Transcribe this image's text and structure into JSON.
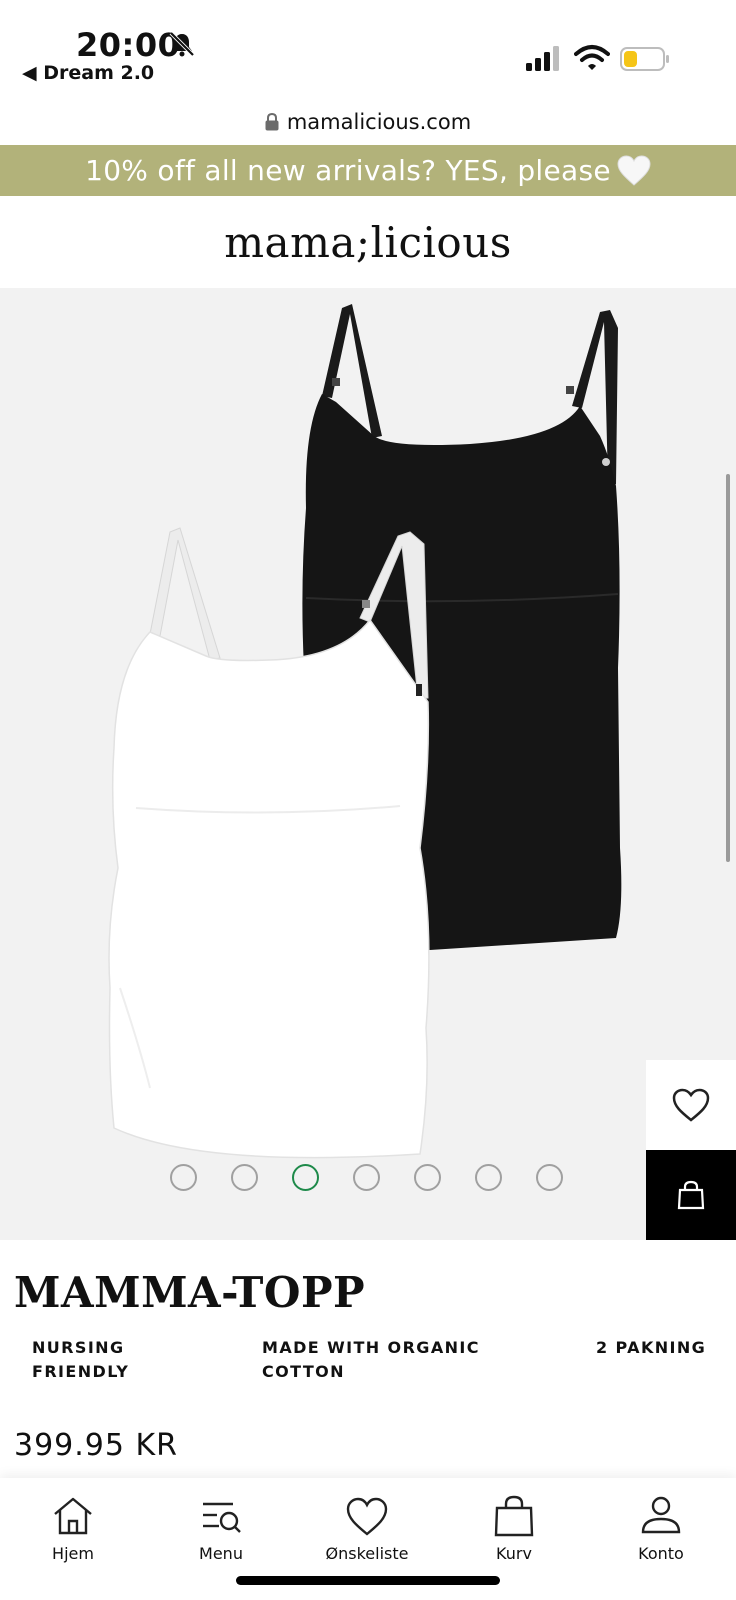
{
  "status_bar": {
    "time": "20:00",
    "back_app": "◀ Dream 2.0",
    "battery_color": "#f5c518"
  },
  "browser": {
    "url": "mamalicious.com"
  },
  "promo": {
    "text": "10% off all new arrivals? YES, please",
    "background": "#b2b27a"
  },
  "brand": {
    "logo": "mama;licious"
  },
  "gallery": {
    "dot_count": 7,
    "active_index": 2,
    "active_color": "#1e8a4a"
  },
  "product": {
    "title": "MAMMA-TOPP",
    "features": [
      "NURSING FRIENDLY",
      "MADE WITH ORGANIC COTTON",
      "2 PAKNING"
    ],
    "price": "399.95 KR"
  },
  "bottom_nav": {
    "items": [
      {
        "label": "Hjem",
        "icon": "home-icon"
      },
      {
        "label": "Menu",
        "icon": "menu-search-icon"
      },
      {
        "label": "Ønskeliste",
        "icon": "heart-icon"
      },
      {
        "label": "Kurv",
        "icon": "bag-icon"
      },
      {
        "label": "Konto",
        "icon": "user-icon"
      }
    ]
  }
}
